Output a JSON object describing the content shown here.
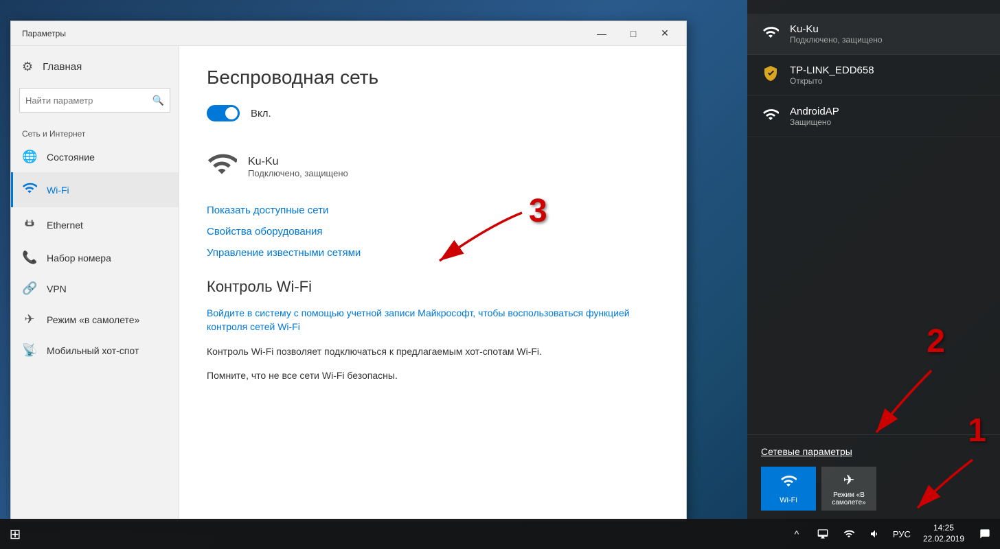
{
  "window": {
    "title": "Параметры",
    "minimize_label": "—",
    "maximize_label": "□",
    "close_label": "✕"
  },
  "sidebar": {
    "home_label": "Главная",
    "search_placeholder": "Найти параметр",
    "section_label": "Сеть и Интернет",
    "items": [
      {
        "id": "status",
        "label": "Состояние",
        "icon": "🌐"
      },
      {
        "id": "wifi",
        "label": "Wi-Fi",
        "icon": "📶",
        "active": true
      },
      {
        "id": "ethernet",
        "label": "Ethernet",
        "icon": "🖥"
      },
      {
        "id": "dialup",
        "label": "Набор номера",
        "icon": "📞"
      },
      {
        "id": "vpn",
        "label": "VPN",
        "icon": "🔗"
      },
      {
        "id": "airplane",
        "label": "Режим «в самолете»",
        "icon": "✈"
      },
      {
        "id": "hotspot",
        "label": "Мобильный хот-спот",
        "icon": "📡"
      }
    ]
  },
  "main": {
    "page_title": "Беспроводная сеть",
    "toggle_label": "Вкл.",
    "connected_network": {
      "name": "Ku-Ku",
      "status": "Подключено, защищено"
    },
    "links": {
      "show_networks": "Показать доступные сети",
      "adapter_properties": "Свойства оборудования",
      "manage_known": "Управление известными сетями"
    },
    "wifi_sense": {
      "title": "Контроль Wi-Fi",
      "link_text": "Войдите в систему с помощью учетной записи Майкрософт, чтобы воспользоваться функцией контроля сетей Wi-Fi",
      "desc1": "Контроль Wi-Fi позволяет подключаться к предлагаемым хот-спотам Wi-Fi.",
      "desc2": "Помните, что не все сети Wi-Fi безопасны."
    }
  },
  "flyout": {
    "networks": [
      {
        "id": "kuku",
        "name": "Ku-Ku",
        "status": "Подключено, защищено",
        "icon": "wifi",
        "connected": true
      },
      {
        "id": "tp-link",
        "name": "TP-LINK_EDD658",
        "status": "Открыто",
        "icon": "shield"
      },
      {
        "id": "androidap",
        "name": "AndroidAP",
        "status": "Защищено",
        "icon": "wifi"
      }
    ],
    "settings_link": "Сетевые параметры",
    "quick_actions": [
      {
        "id": "wifi",
        "label": "Wi-Fi",
        "icon": "📶",
        "active": true
      },
      {
        "id": "airplane",
        "label": "Режим «В самолете»",
        "icon": "✈",
        "active": false
      }
    ]
  },
  "taskbar": {
    "time": "14:25",
    "date": "22.02.2019",
    "language": "РУС",
    "icons": [
      "^",
      "📺",
      "📶",
      "🔊",
      "💬"
    ]
  },
  "annotations": {
    "num1": "1",
    "num2": "2",
    "num3": "3"
  }
}
